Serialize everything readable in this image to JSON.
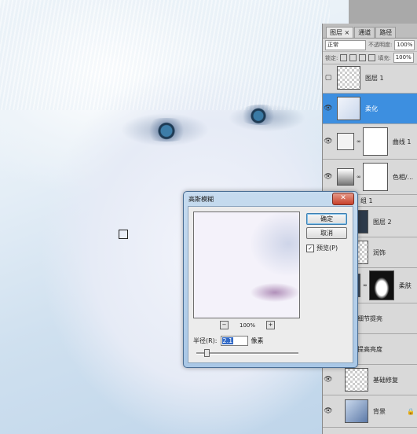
{
  "panel": {
    "tabs": [
      "图层 ×",
      "通道",
      "路径"
    ],
    "blend_mode": "正常",
    "opacity_label": "不透明度:",
    "opacity_value": "100%",
    "lock_label": "锁定:",
    "fill_label": "填充:",
    "fill_value": "100%"
  },
  "layers": [
    {
      "name": "图层 1",
      "visible": false,
      "selected": false
    },
    {
      "name": "柔化",
      "visible": true,
      "selected": true
    },
    {
      "name": "曲线 1",
      "visible": true,
      "selected": false
    },
    {
      "name": "色相/...",
      "visible": true,
      "selected": false
    },
    {
      "name": "组 1",
      "visible": true,
      "selected": false
    },
    {
      "name": "图层 2",
      "visible": true,
      "selected": false
    },
    {
      "name": "润饰",
      "visible": true,
      "selected": false
    },
    {
      "name": "柔肤",
      "visible": true,
      "selected": false
    },
    {
      "name": "细节提亮",
      "visible": true,
      "selected": false
    },
    {
      "name": "提高亮度",
      "visible": true,
      "selected": false
    },
    {
      "name": "基础修复",
      "visible": true,
      "selected": false
    },
    {
      "name": "背景",
      "visible": true,
      "selected": false
    }
  ],
  "dialog": {
    "title": "高斯模糊",
    "close_label": "✕",
    "ok_label": "确定",
    "cancel_label": "取消",
    "preview_label": "预览(P)",
    "preview_checked": true,
    "zoom_value": "100%",
    "zoom_out": "−",
    "zoom_in": "+",
    "radius_label": "半径(R):",
    "radius_value": "2.1",
    "radius_unit": "像素"
  },
  "icons": {
    "eye": "eye-icon",
    "chain": "link-icon",
    "lock": "lock-icon"
  },
  "colors": {
    "selection": "#3d8fe0",
    "dialog_frame": "#a9c7e6",
    "close": "#c8402a"
  }
}
